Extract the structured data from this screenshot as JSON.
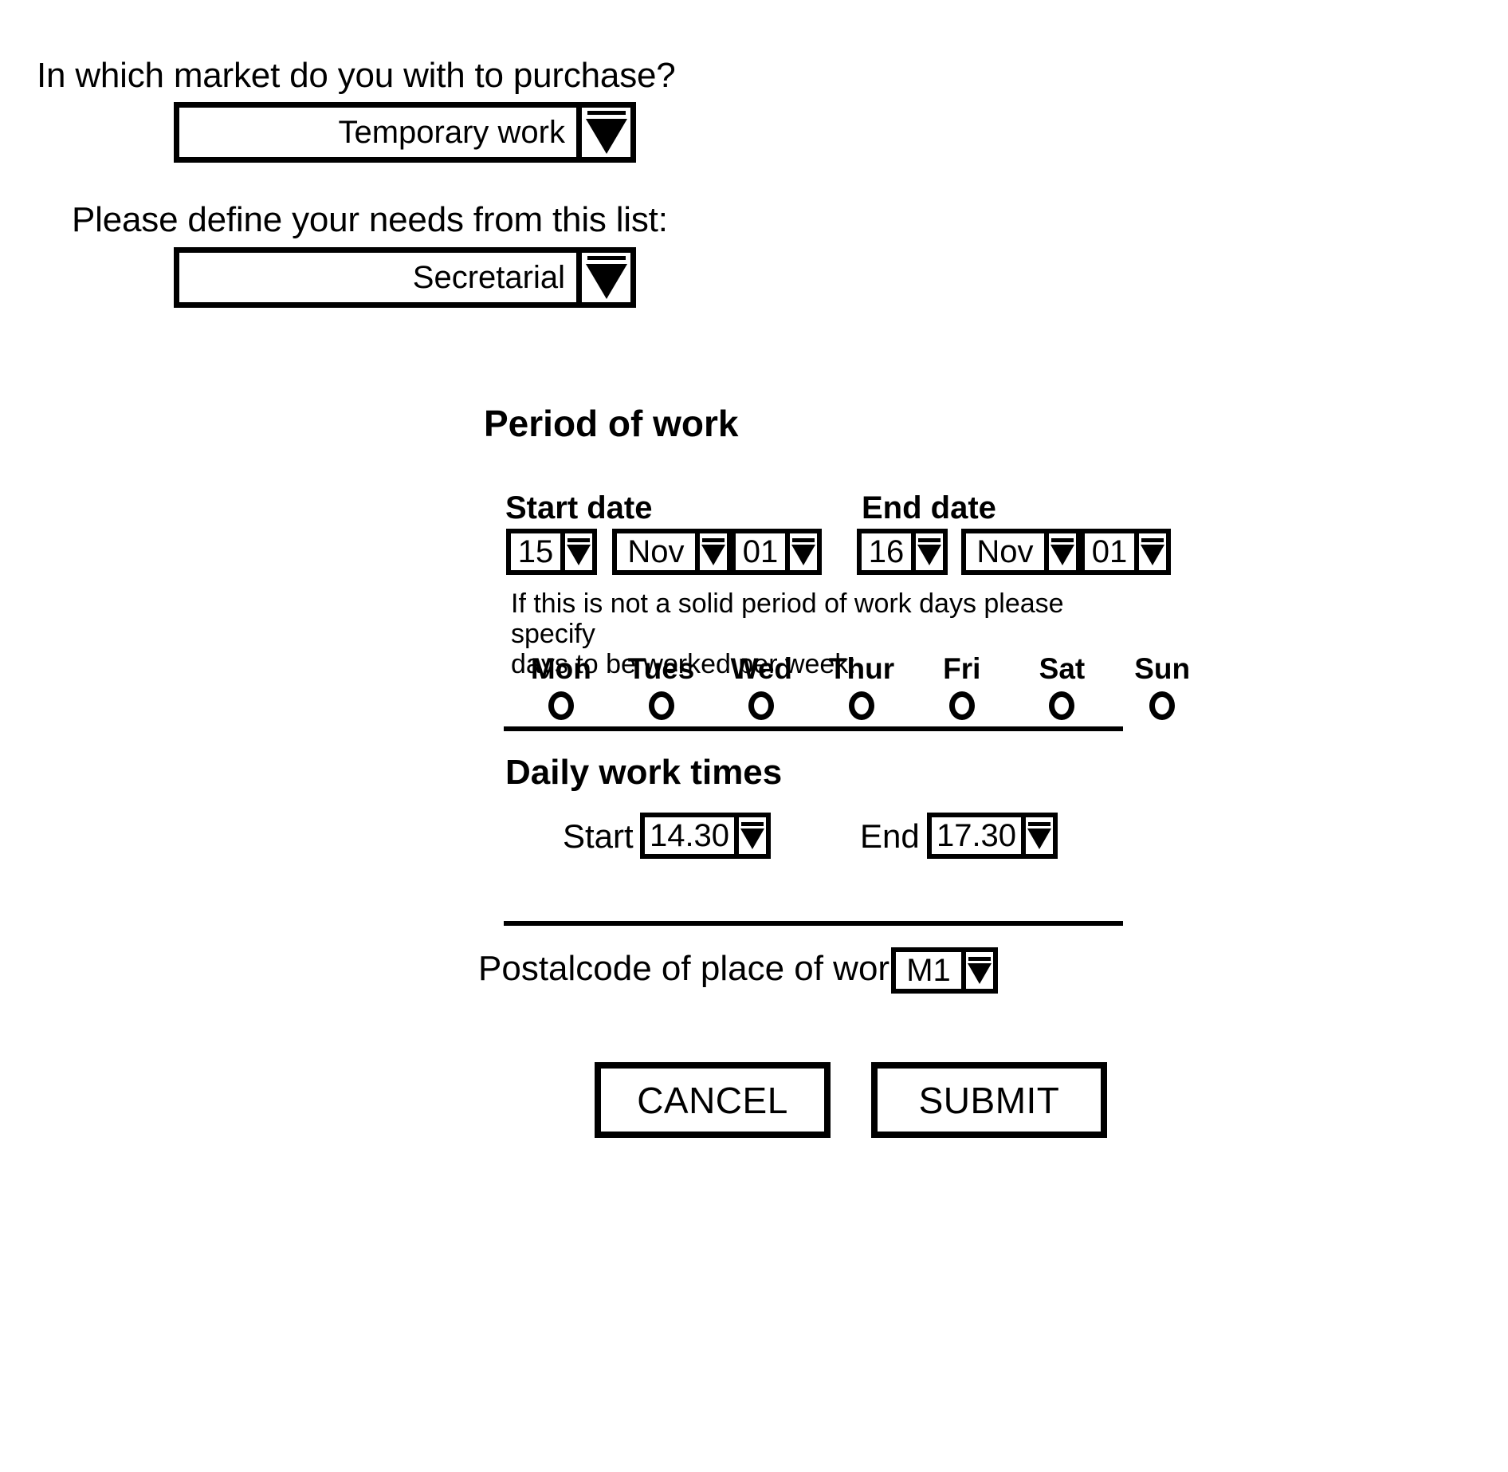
{
  "form": {
    "market_question": {
      "label": "In which market do you with to purchase?",
      "selected": "Temporary work"
    },
    "needs_question": {
      "label": "Please define your needs from this list:",
      "selected": "Secretarial"
    },
    "period_of_work": {
      "heading": "Period of work",
      "start_date": {
        "label": "Start date",
        "day": "15",
        "month": "Nov",
        "year": "01"
      },
      "end_date": {
        "label": "End date",
        "day": "16",
        "month": "Nov",
        "year": "01"
      },
      "note_line1": "If this is not a solid period of work days please specify",
      "note_line2": "days to be worked per week:",
      "days": [
        {
          "name": "Mon",
          "selected": false
        },
        {
          "name": "Tues",
          "selected": false
        },
        {
          "name": "Wed",
          "selected": false
        },
        {
          "name": "Thur",
          "selected": false
        },
        {
          "name": "Fri",
          "selected": false
        },
        {
          "name": "Sat",
          "selected": false
        },
        {
          "name": "Sun",
          "selected": false
        }
      ]
    },
    "daily_work_times": {
      "heading": "Daily work times",
      "start_label": "Start",
      "start_value": "14.30",
      "end_label": "End",
      "end_value": "17.30"
    },
    "postalcode": {
      "label": "Postalcode of place of work",
      "value": "M1"
    },
    "actions": {
      "cancel_label": "CANCEL",
      "submit_label": "SUBMIT"
    }
  },
  "colors": {
    "ink": "#000000",
    "paper": "#ffffff"
  }
}
